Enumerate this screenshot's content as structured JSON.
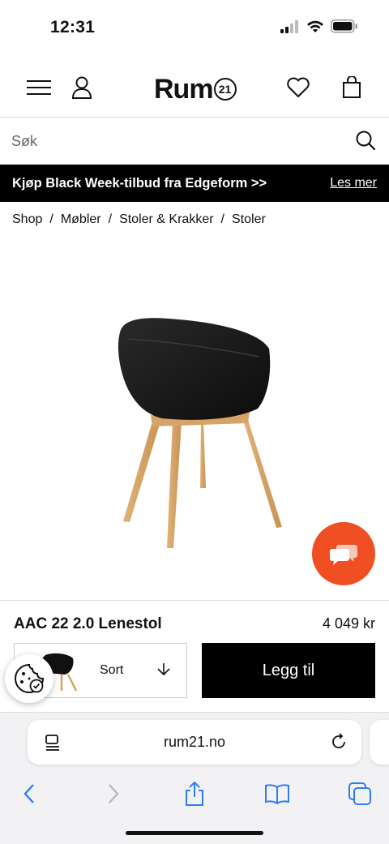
{
  "status": {
    "time": "12:31"
  },
  "header": {
    "logo_text": "Rum",
    "logo_number": "21",
    "icons": [
      "menu-icon",
      "user-icon",
      "heart-icon",
      "bag-icon"
    ]
  },
  "search": {
    "placeholder": "Søk"
  },
  "promo": {
    "text": "Kjøp Black Week-tilbud fra Edgeform >>",
    "link": "Les mer"
  },
  "breadcrumb": [
    "Shop",
    "Møbler",
    "Stoler & Krakker",
    "Stoler"
  ],
  "breadcrumb_separator": "/",
  "product": {
    "name": "AAC 22 2.0 Lenestol",
    "price": "4 049 kr",
    "variant": "Sort",
    "add_to_cart": "Legg til"
  },
  "colors": {
    "accent_chat": "#f04e23",
    "promo_bg": "#000000",
    "ios_blue": "#2f7cf6"
  },
  "browser": {
    "url": "rum21.no"
  }
}
